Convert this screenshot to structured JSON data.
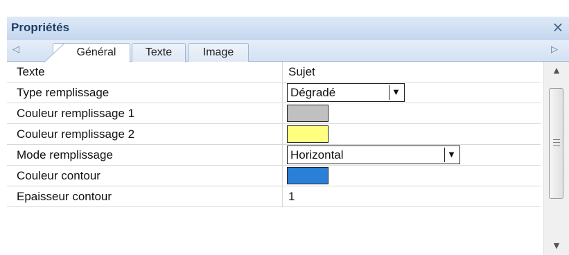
{
  "panel": {
    "title": "Propriétés",
    "close_glyph": "×"
  },
  "tabs": {
    "scroll_left_glyph": "◁",
    "scroll_right_glyph": "▷",
    "items": [
      {
        "label": "Général",
        "active": true
      },
      {
        "label": "Texte",
        "active": false
      },
      {
        "label": "Image",
        "active": false
      }
    ]
  },
  "properties": [
    {
      "name": "Texte",
      "value": "Sujet"
    },
    {
      "name": "Type remplissage",
      "value": "Dégradé",
      "control": "select"
    },
    {
      "name": "Couleur remplissage 1",
      "color": "#c0c0c0",
      "control": "swatch"
    },
    {
      "name": "Couleur remplissage 2",
      "color": "#ffff80",
      "control": "swatch"
    },
    {
      "name": "Mode remplissage",
      "value": "Horizontal",
      "control": "select"
    },
    {
      "name": "Couleur contour",
      "color": "#2a7fd6",
      "control": "swatch"
    },
    {
      "name": "Epaisseur contour",
      "value": "1"
    }
  ],
  "dropdown_glyph": "▼",
  "scrollbar": {
    "up_glyph": "▲",
    "down_glyph": "▼"
  }
}
